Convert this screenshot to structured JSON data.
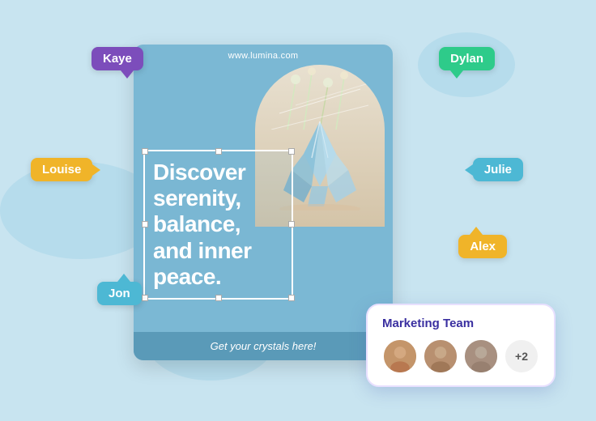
{
  "background_color": "#c8e4f0",
  "card": {
    "url": "www.lumina.com",
    "main_text": "Discover serenity, balance, and inner peace.",
    "footer_text": "Get your crystals here!"
  },
  "name_tags": [
    {
      "id": "kaye",
      "label": "Kaye",
      "color": "#7c4dbb"
    },
    {
      "id": "dylan",
      "label": "Dylan",
      "color": "#2ecb8a"
    },
    {
      "id": "louise",
      "label": "Louise",
      "color": "#f0b429"
    },
    {
      "id": "julie",
      "label": "Julie",
      "color": "#4db8d4"
    },
    {
      "id": "alex",
      "label": "Alex",
      "color": "#f0b429"
    },
    {
      "id": "jon",
      "label": "Jon",
      "color": "#4db8d4"
    }
  ],
  "marketing_team": {
    "title": "Marketing Team",
    "extra_count": "+2"
  }
}
